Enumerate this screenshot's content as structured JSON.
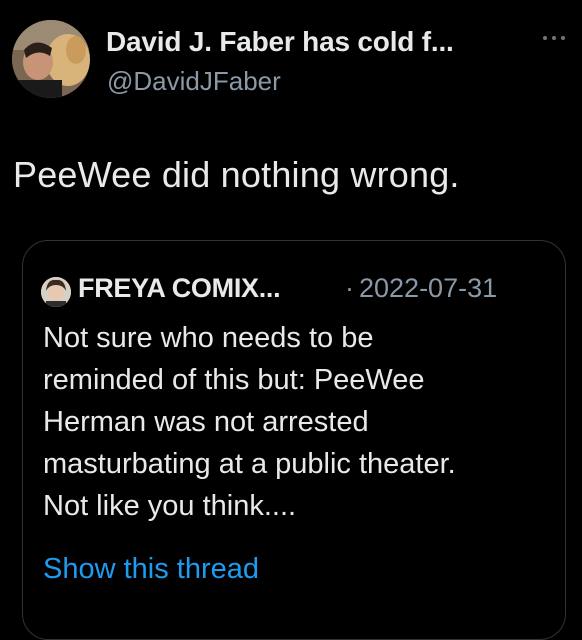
{
  "tweet": {
    "author": {
      "display_name": "David J. Faber has cold f...",
      "handle": "@DavidJFaber",
      "avatar_icon": "profile-photo-man-with-dog"
    },
    "more_icon": "more-horizontal-icon",
    "text": "PeeWee did nothing wrong.",
    "quote": {
      "author": "FREYA COMIX...",
      "separator": "·",
      "date": "2022-07-31",
      "avatar_icon": "profile-photo-woman",
      "body_lines": [
        "Not sure who needs to be",
        "reminded of this but: PeeWee",
        "Herman was not arrested",
        "masturbating at a public theater.",
        "Not like you think...."
      ],
      "show_thread_label": "Show this thread"
    }
  },
  "colors": {
    "background": "#000000",
    "primary_text": "#e7e9ea",
    "secondary_text": "#8b98a5",
    "link": "#1d9bf0",
    "border": "#2f3336"
  }
}
